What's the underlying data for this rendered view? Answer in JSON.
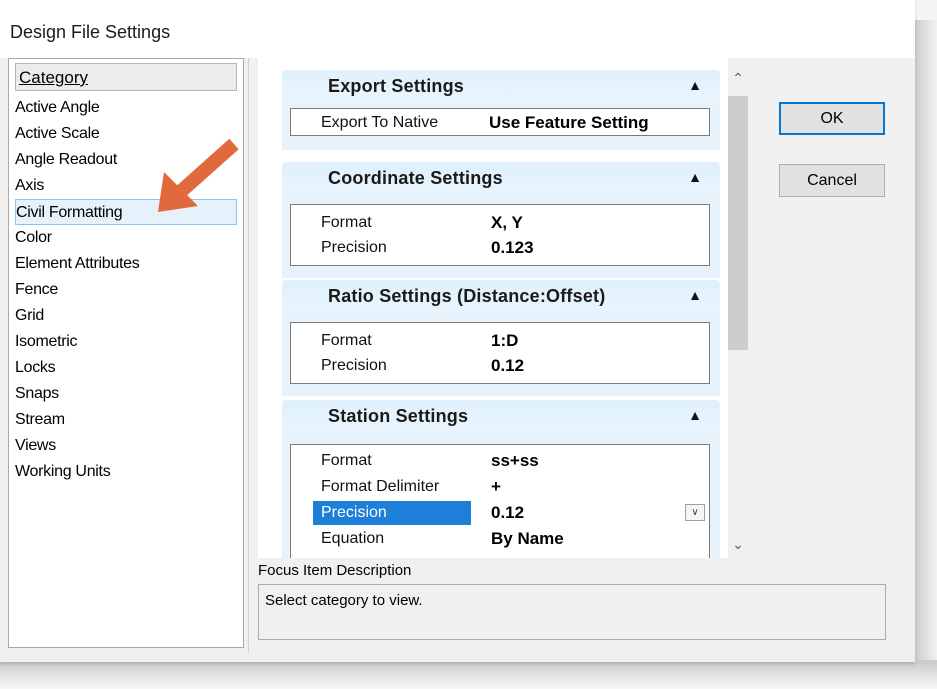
{
  "window": {
    "title": "Design File Settings"
  },
  "category": {
    "header": "Category",
    "items": [
      "Active Angle",
      "Active Scale",
      "Angle Readout",
      "Axis",
      "Civil Formatting",
      "Color",
      "Element Attributes",
      "Fence",
      "Grid",
      "Isometric",
      "Locks",
      "Snaps",
      "Stream",
      "Views",
      "Working Units"
    ],
    "selected": "Civil Formatting"
  },
  "sections": {
    "export": {
      "title": "Export Settings",
      "rows": [
        {
          "label": "Export To Native",
          "value": "Use Feature Setting"
        }
      ]
    },
    "coordinate": {
      "title": "Coordinate Settings",
      "rows": [
        {
          "label": "Format",
          "value": "X, Y"
        },
        {
          "label": "Precision",
          "value": "0.123"
        }
      ]
    },
    "ratio": {
      "title": "Ratio Settings (Distance:Offset)",
      "rows": [
        {
          "label": "Format",
          "value": "1:D"
        },
        {
          "label": "Precision",
          "value": "0.12"
        }
      ]
    },
    "station": {
      "title": "Station Settings",
      "rows": [
        {
          "label": "Format",
          "value": "ss+ss"
        },
        {
          "label": "Format Delimiter",
          "value": "+"
        },
        {
          "label": "Precision",
          "value": "0.12"
        },
        {
          "label": "Equation",
          "value": "By Name"
        }
      ]
    }
  },
  "buttons": {
    "ok": "OK",
    "cancel": "Cancel"
  },
  "description": {
    "label": "Focus Item Description",
    "text": "Select category to view."
  },
  "colors": {
    "selection": "#1d7fd8",
    "section_header": "#e1f1fd",
    "arrow": "#e06a3b"
  }
}
